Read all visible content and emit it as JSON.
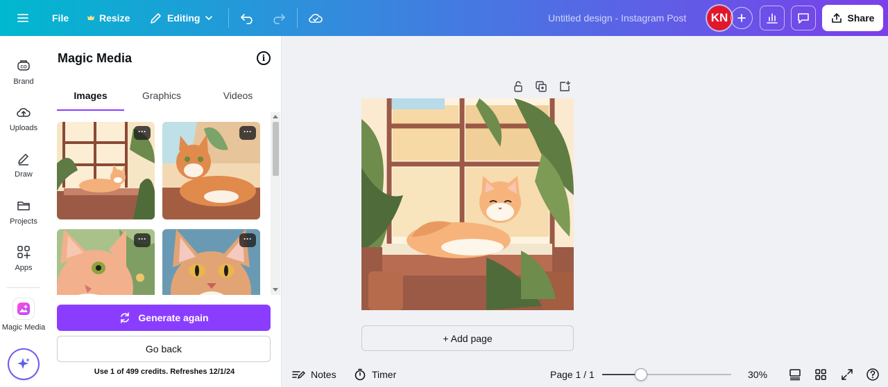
{
  "topbar": {
    "file_label": "File",
    "resize_label": "Resize",
    "editing_label": "Editing",
    "doc_title": "Untitled design - Instagram Post",
    "avatar_initials": "KN",
    "share_label": "Share",
    "gradient_colors": [
      "#00b8cf",
      "#7b3fe9"
    ]
  },
  "rail": {
    "items": [
      {
        "label": "Brand",
        "icon": "brand-icon"
      },
      {
        "label": "Uploads",
        "icon": "cloud-upload-icon"
      },
      {
        "label": "Draw",
        "icon": "pen-icon"
      },
      {
        "label": "Projects",
        "icon": "folder-icon"
      },
      {
        "label": "Apps",
        "icon": "apps-grid-icon"
      },
      {
        "label": "Magic Media",
        "icon": "magic-media-icon"
      }
    ]
  },
  "panel": {
    "title": "Magic Media",
    "tabs": [
      "Images",
      "Graphics",
      "Videos"
    ],
    "active_tab": "Images",
    "generate_label": "Generate again",
    "back_label": "Go back",
    "credits_text": "Use 1 of 499 credits. Refreshes 12/1/24",
    "more_label": "···",
    "accent_color": "#8b3dff"
  },
  "canvas": {
    "add_page_label": "+ Add page"
  },
  "bottombar": {
    "notes_label": "Notes",
    "timer_label": "Timer",
    "page_label": "Page 1 / 1",
    "zoom_label": "30%",
    "zoom_fraction": 0.3
  }
}
